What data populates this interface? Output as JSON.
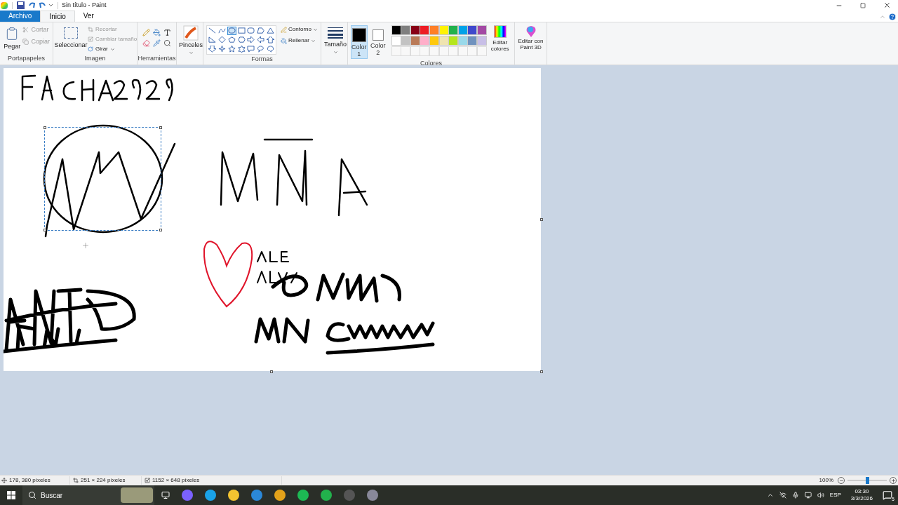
{
  "window": {
    "title": "Sin título - Paint"
  },
  "tabs": [
    {
      "label": "Archivo",
      "kind": "file",
      "selected": false
    },
    {
      "label": "Inicio",
      "kind": "tab",
      "selected": true
    },
    {
      "label": "Ver",
      "kind": "tab",
      "selected": false
    }
  ],
  "ribbon": {
    "clipboard": {
      "paste": "Pegar",
      "cut": "Cortar",
      "copy": "Copiar",
      "label": "Portapapeles"
    },
    "image": {
      "select": "Seleccionar",
      "crop": "Recortar",
      "resize": "Cambiar tamaño",
      "rotate": "Girar",
      "label": "Imagen"
    },
    "tools": {
      "label": "Herramientas"
    },
    "brushes": {
      "label": "Pinceles"
    },
    "shapes": {
      "items": [
        {
          "selected": false
        },
        {
          "selected": false
        },
        {
          "selected": true
        },
        {
          "selected": false
        },
        {
          "selected": false
        },
        {
          "selected": false
        },
        {
          "selected": false
        },
        {
          "selected": false
        },
        {
          "selected": false
        },
        {
          "selected": false
        },
        {
          "selected": false
        },
        {
          "selected": false
        },
        {
          "selected": false
        },
        {
          "selected": false
        },
        {
          "selected": false
        },
        {
          "selected": false
        },
        {
          "selected": false
        },
        {
          "selected": false
        },
        {
          "selected": false
        },
        {
          "selected": false
        },
        {
          "selected": false
        }
      ],
      "outline": "Contorno",
      "fill": "Rellenar",
      "label": "Formas"
    },
    "size": {
      "label": "Tamaño"
    },
    "colors": {
      "color1": {
        "label": "Color",
        "number": "1",
        "color": "#000000",
        "selected": true
      },
      "color2": {
        "label": "Color",
        "number": "2",
        "color": "#ffffff",
        "selected": false
      },
      "palette": [
        {
          "color": "#000000"
        },
        {
          "color": "#7f7f7f"
        },
        {
          "color": "#880015"
        },
        {
          "color": "#ed1c24"
        },
        {
          "color": "#ff7f27"
        },
        {
          "color": "#fff200"
        },
        {
          "color": "#22b14c"
        },
        {
          "color": "#00a2e8"
        },
        {
          "color": "#3f48cc"
        },
        {
          "color": "#a349a4"
        },
        {
          "color": "#ffffff"
        },
        {
          "color": "#c3c3c3"
        },
        {
          "color": "#b97a57"
        },
        {
          "color": "#ffaec9"
        },
        {
          "color": "#ffc90e"
        },
        {
          "color": "#efe4b0"
        },
        {
          "color": "#b5e61d"
        },
        {
          "color": "#99d9ea"
        },
        {
          "color": "#7092be"
        },
        {
          "color": "#c8bfe7"
        }
      ],
      "edit": "Editar colores",
      "label": "Colores"
    },
    "paint3d": "Editar con Paint 3D"
  },
  "status_bar": {
    "cursor": "178, 380 píxeles",
    "selection": "251 × 224 píxeles",
    "canvas": "1152 × 648 píxeles",
    "zoom": "100%",
    "zoom_slider": {
      "level": 0.5
    }
  },
  "taskbar": {
    "search": "Buscar",
    "tray": {
      "language": "ESP",
      "time": "03:30",
      "date": "3/3/2026",
      "notifications": "5"
    }
  }
}
